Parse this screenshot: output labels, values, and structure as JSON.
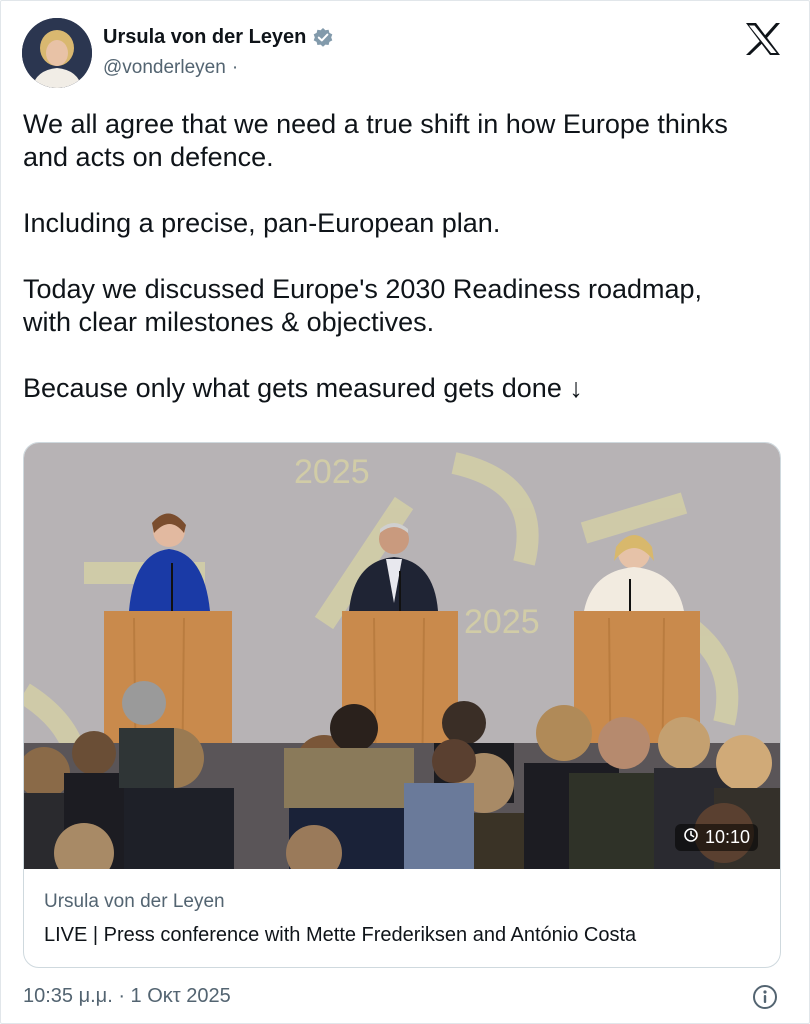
{
  "author": {
    "name": "Ursula von der Leyen",
    "handle": "@vonderleyen",
    "handle_separator": "·"
  },
  "brand": {
    "logo_icon": "x-logo-icon"
  },
  "tweet": {
    "paragraphs": [
      "We all agree that we need a true shift in how Europe thinks\nand acts on defence.",
      "Including a precise, pan-European plan.",
      "Today we discussed Europe's 2030 Readiness roadmap,\nwith clear milestones & objectives.",
      "Because only what gets measured gets done ↓"
    ]
  },
  "card": {
    "duration": "10:10",
    "author": "Ursula von der Leyen",
    "title": "LIVE | Press conference with Mette Frederiksen and António Costa"
  },
  "footer": {
    "timestamp": "10:35 μ.μ. · 1 Οκτ 2025"
  },
  "colors": {
    "verified": "#829aab",
    "secondary_text": "#536471",
    "border": "#cfd9de"
  }
}
